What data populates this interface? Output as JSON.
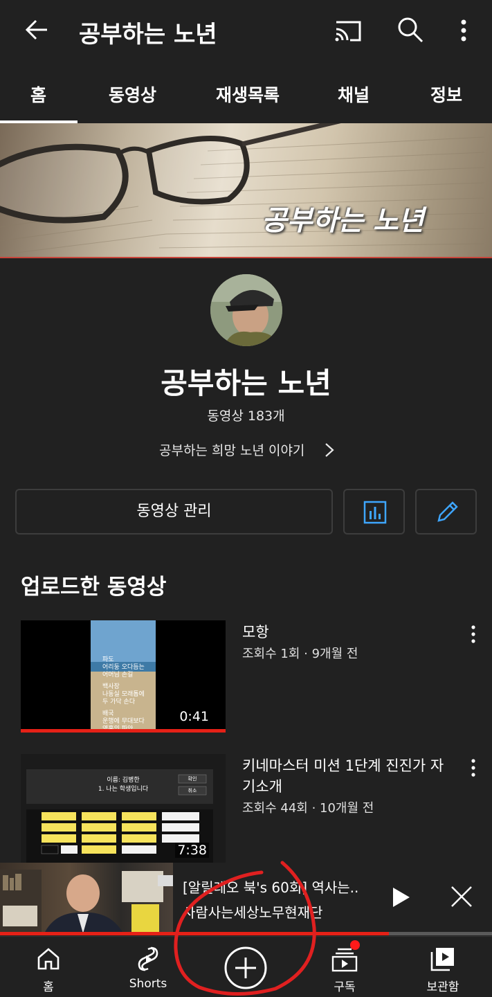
{
  "appbar": {
    "title": "공부하는 노년",
    "icons": [
      "back-arrow-icon",
      "cast-icon",
      "search-icon",
      "more-vert-icon"
    ]
  },
  "tabs": [
    {
      "label": "홈",
      "selected": true
    },
    {
      "label": "동영상",
      "selected": false
    },
    {
      "label": "재생목록",
      "selected": false
    },
    {
      "label": "채널",
      "selected": false
    },
    {
      "label": "정보",
      "selected": false
    }
  ],
  "banner": {
    "text": "공부하는 노년"
  },
  "channel": {
    "name": "공부하는 노년",
    "video_count": "동영상 183개",
    "tagline": "공부하는 희망 노년 이야기"
  },
  "actions": {
    "manage_label": "동영상 관리",
    "stats_icon": "analytics-icon",
    "edit_icon": "pencil-icon",
    "accent": "#3ea6ff"
  },
  "section": {
    "title": "업로드한 동영상"
  },
  "videos": [
    {
      "title": "모항",
      "meta": "조회수 1회 · 9개월 전",
      "duration": "0:41",
      "watched_fraction": 1.0,
      "thumb_text": [
        "파도",
        "어리둥 오다듬는",
        "어머님 손길",
        "백사장",
        "나동실 모래톱에",
        "두 가닥 손다",
        "배국",
        "운행에 무대보다",
        "영혼의 파안"
      ]
    },
    {
      "title": "키네마스터 미션 1단계 진진가 자기소개",
      "meta": "조회수 44회 · 10개월 전",
      "duration": "7:38",
      "thumb_text": [
        "이름: 김병한",
        "1. 나는 학생입니다",
        "확인",
        "취소"
      ]
    }
  ],
  "miniplayer": {
    "title_line1": "[알릴레오 북's 60회] 역사는..",
    "title_line2": "사람사는세상노무현재단",
    "progress_fraction": 0.79
  },
  "bottomnav": [
    {
      "label": "홈",
      "icon": "home-icon"
    },
    {
      "label": "Shorts",
      "icon": "shorts-icon"
    },
    {
      "label": "",
      "icon": "create-plus-icon"
    },
    {
      "label": "구독",
      "icon": "subscriptions-icon",
      "badge": true
    },
    {
      "label": "보관함",
      "icon": "library-icon"
    }
  ],
  "colors": {
    "background": "#212121",
    "progress": "#e52117",
    "badge": "#ff1a1a",
    "annotation": "#e02020"
  }
}
